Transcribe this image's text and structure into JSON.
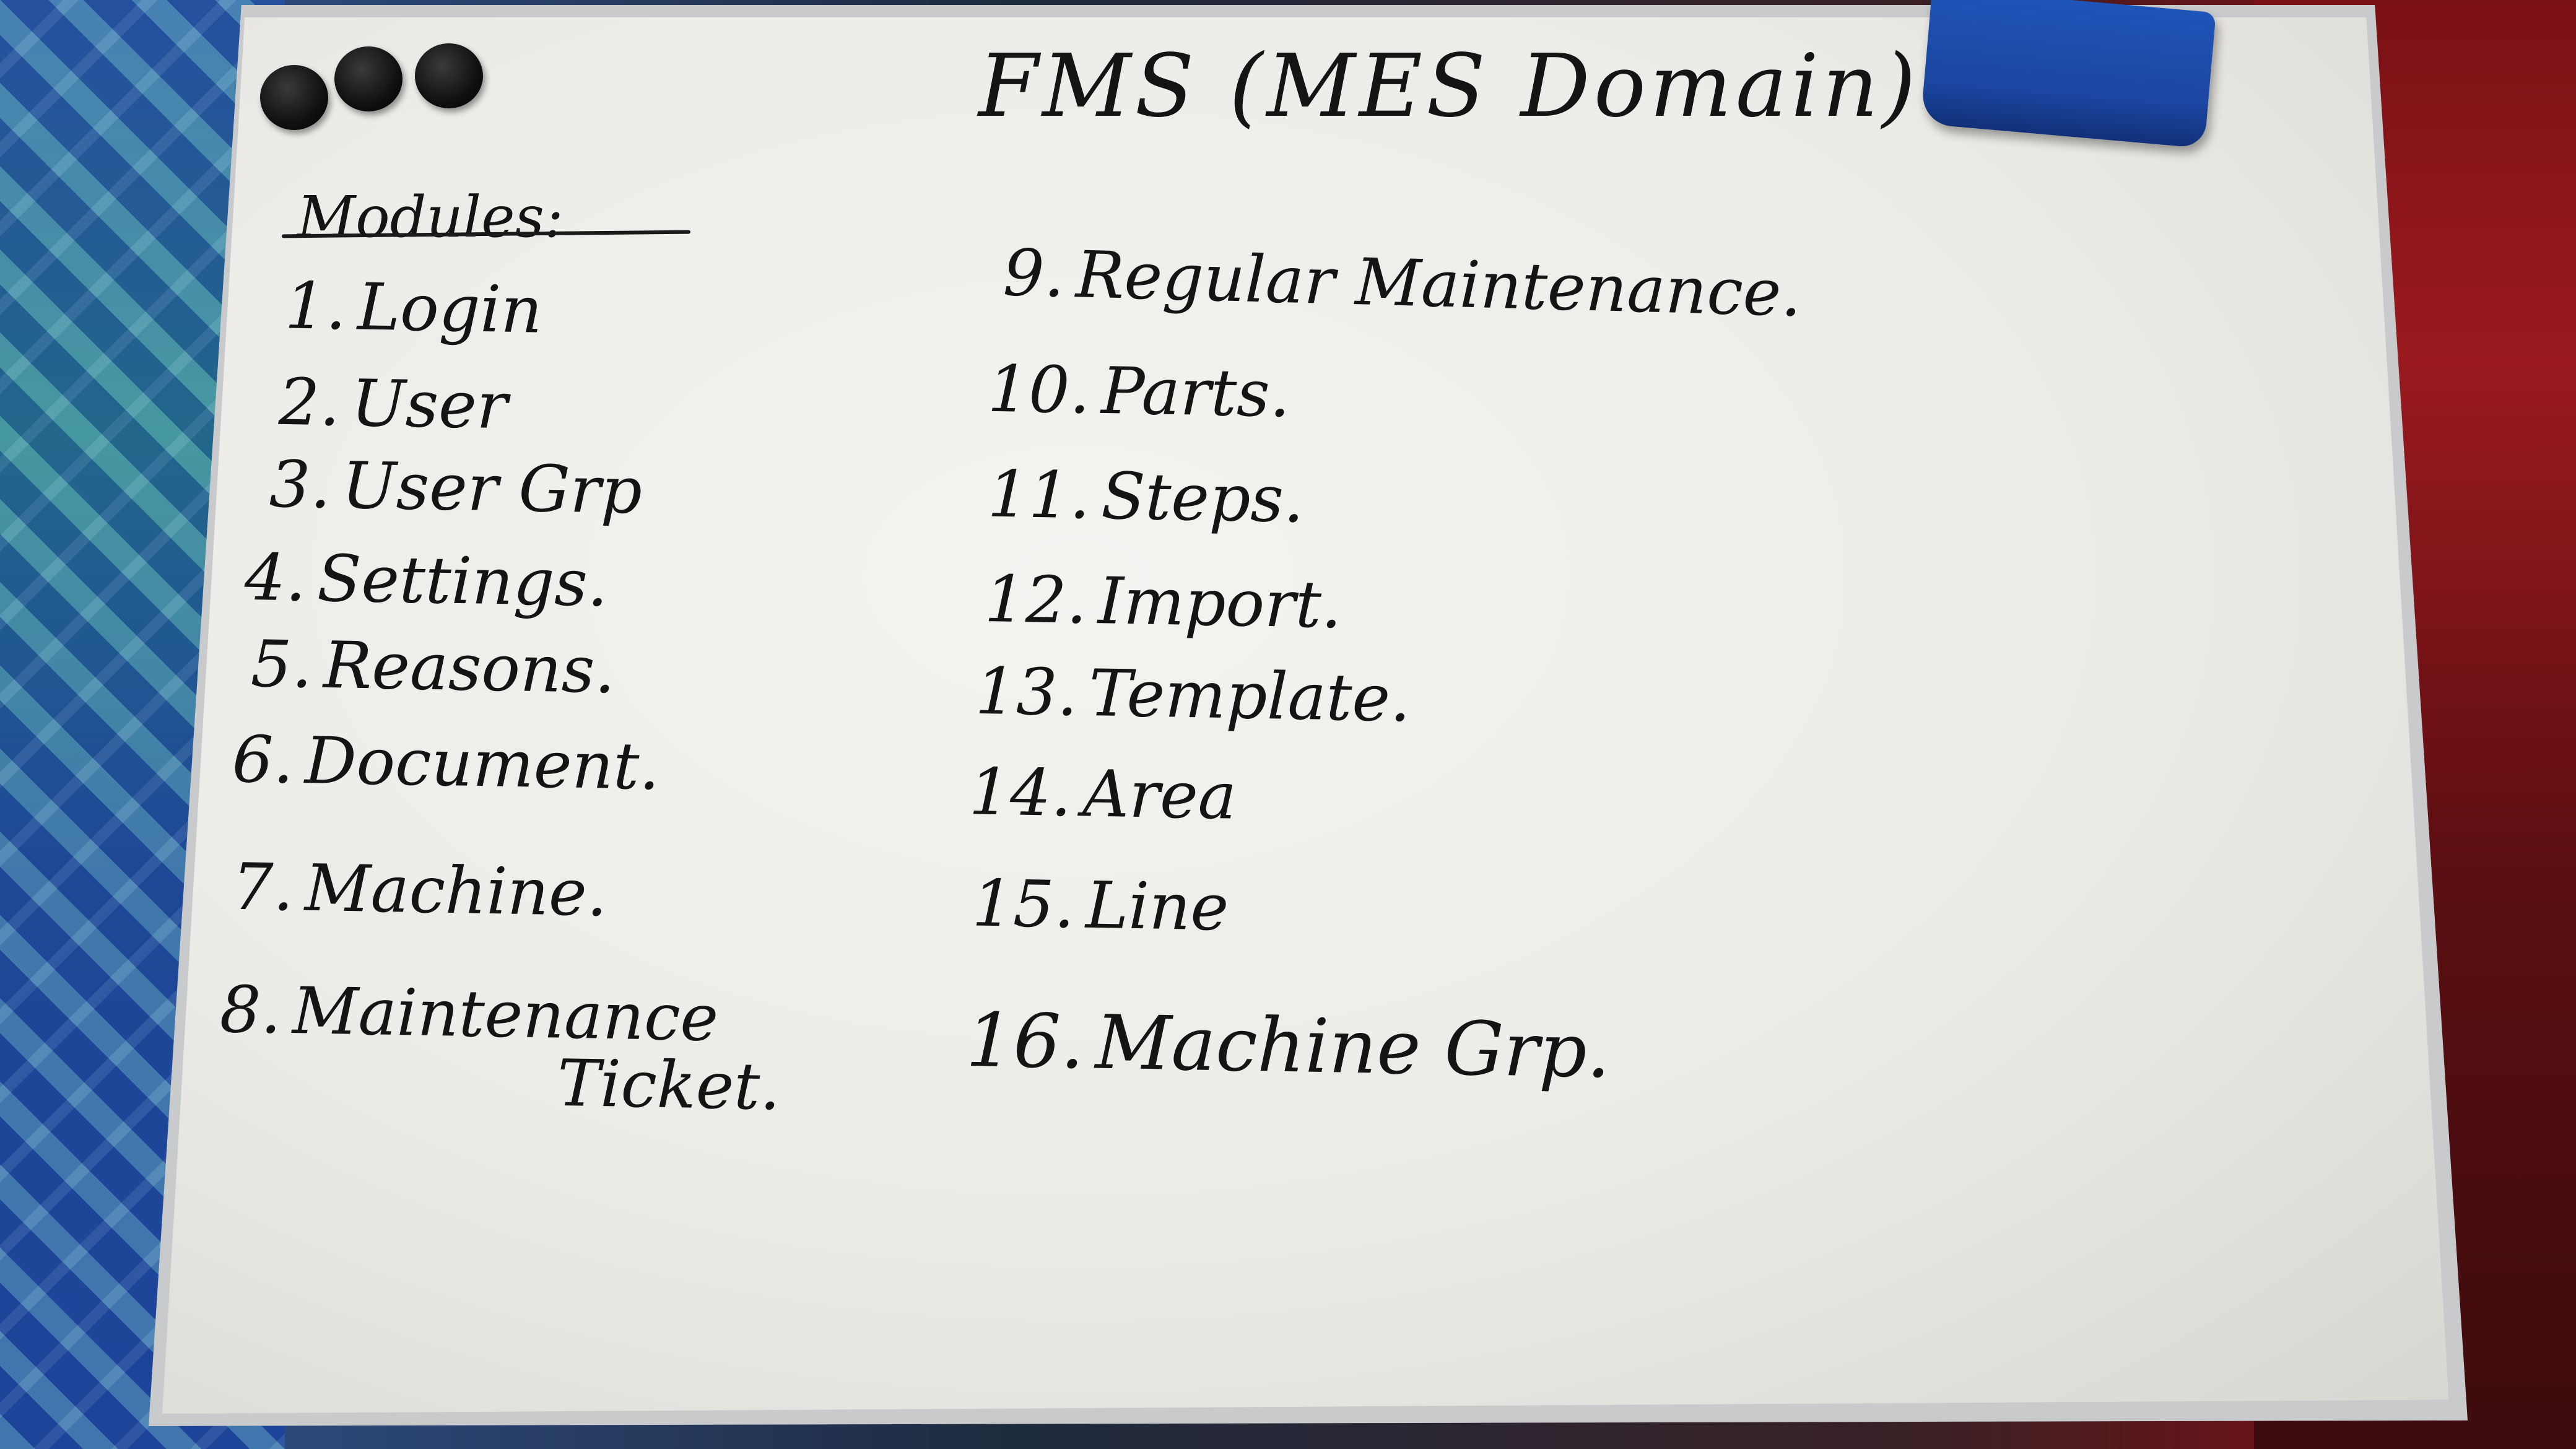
{
  "board": {
    "title": "FMS (MES Domain)",
    "heading": "Modules:",
    "modules_left": [
      {
        "num": "1.",
        "label": "Login"
      },
      {
        "num": "2.",
        "label": "User"
      },
      {
        "num": "3.",
        "label": "User Grp"
      },
      {
        "num": "4.",
        "label": "Settings."
      },
      {
        "num": "5.",
        "label": "Reasons."
      },
      {
        "num": "6.",
        "label": "Document."
      },
      {
        "num": "7.",
        "label": "Machine."
      },
      {
        "num": "8.",
        "label": "Maintenance"
      }
    ],
    "module_8_cont": "Ticket.",
    "modules_right": [
      {
        "num": "9.",
        "label": "Regular Maintenance."
      },
      {
        "num": "10.",
        "label": "Parts."
      },
      {
        "num": "11.",
        "label": "Steps."
      },
      {
        "num": "12.",
        "label": "Import."
      },
      {
        "num": "13.",
        "label": "Template."
      },
      {
        "num": "14.",
        "label": "Area"
      },
      {
        "num": "15.",
        "label": "Line"
      },
      {
        "num": "16.",
        "label": "Machine Grp."
      }
    ]
  }
}
